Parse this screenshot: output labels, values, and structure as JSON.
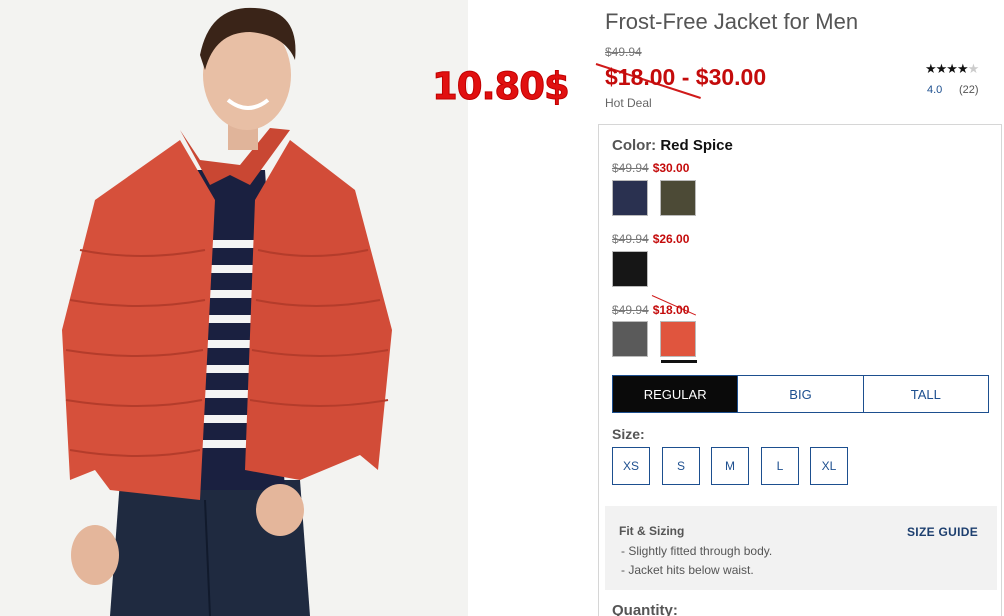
{
  "product": {
    "title": "Frost-Free Jacket for Men",
    "old_price": "$49.94",
    "price_range": "$18.00 - $30.00",
    "deal_label": "Hot Deal",
    "rating": "4.0",
    "rating_count": "(22)",
    "stars_filled": "★★★★",
    "stars_empty": "★"
  },
  "annotation": {
    "handwritten_price": "10.80$",
    "color": "#e11010"
  },
  "color_select": {
    "label": "Color:",
    "value": "Red Spice",
    "tiers": [
      {
        "was": "$49.94",
        "now": "$30.00",
        "swatches": [
          "navy",
          "olive"
        ]
      },
      {
        "was": "$49.94",
        "now": "$26.00",
        "swatches": [
          "black"
        ]
      },
      {
        "was": "$49.94",
        "now": "$18.00",
        "swatches": [
          "charcoal",
          "red-spice"
        ]
      }
    ]
  },
  "fit_tabs": [
    "REGULAR",
    "BIG",
    "TALL"
  ],
  "size": {
    "label": "Size:",
    "options": [
      "XS",
      "S",
      "M",
      "L",
      "XL"
    ]
  },
  "fit_sizing": {
    "title": "Fit & Sizing",
    "lines": [
      "- Slightly fitted through body.",
      "- Jacket hits below waist."
    ],
    "guide_link": "SIZE GUIDE"
  },
  "quantity_label": "Quantity:",
  "colors": {
    "sale_red": "#c40b0b",
    "link_blue": "#1d4f8f",
    "selected_tab": "#0a0a0a"
  }
}
